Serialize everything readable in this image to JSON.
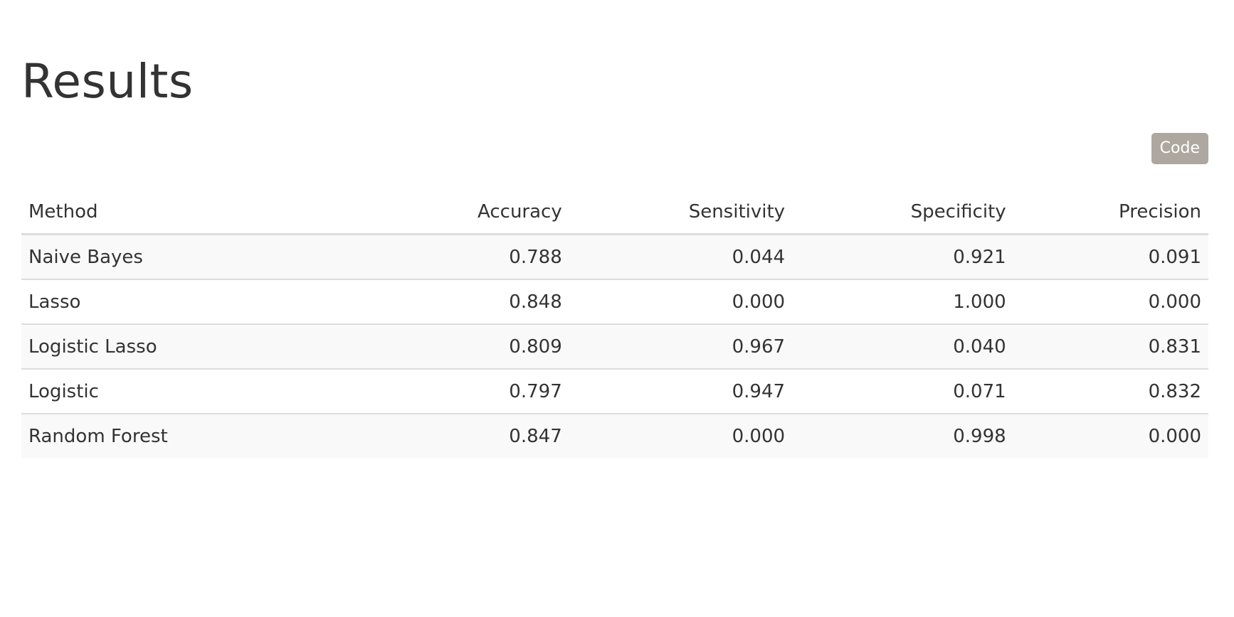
{
  "page": {
    "title": "Results"
  },
  "code_button": {
    "label": "Code",
    "color": "#aea79f"
  },
  "table": {
    "headers": [
      "Method",
      "Accuracy",
      "Sensitivity",
      "Specificity",
      "Precision"
    ],
    "rows": [
      [
        "Naive Bayes",
        "0.788",
        "0.044",
        "0.921",
        "0.091"
      ],
      [
        "Lasso",
        "0.848",
        "0.000",
        "1.000",
        "0.000"
      ],
      [
        "Logistic Lasso",
        "0.809",
        "0.967",
        "0.040",
        "0.831"
      ],
      [
        "Logistic",
        "0.797",
        "0.947",
        "0.071",
        "0.832"
      ],
      [
        "Random Forest",
        "0.847",
        "0.000",
        "0.998",
        "0.000"
      ]
    ]
  }
}
